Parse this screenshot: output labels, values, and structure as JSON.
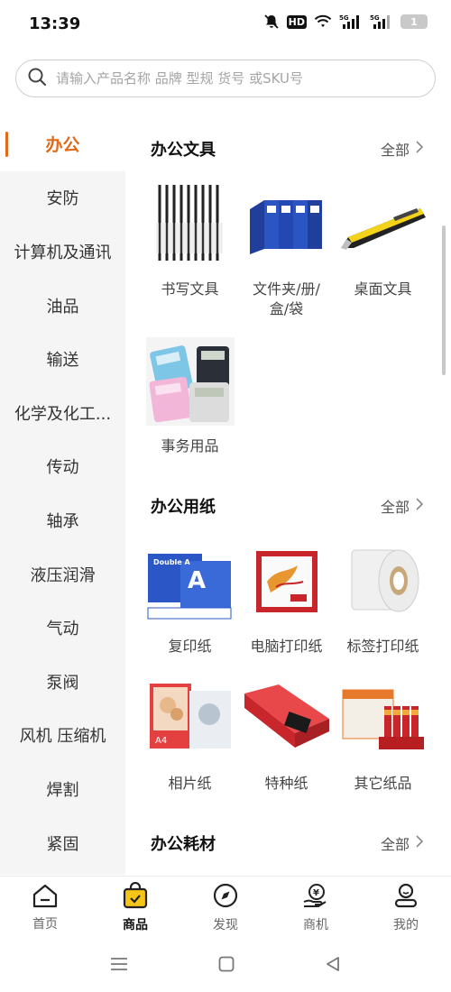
{
  "status": {
    "time": "13:39",
    "hd": "HD",
    "net1": "5G",
    "net2": "5G",
    "battery": "1"
  },
  "search": {
    "placeholder": "请输入产品名称 品牌 型规 货号 或SKU号"
  },
  "sidebar": {
    "items": [
      {
        "label": "办公",
        "active": true
      },
      {
        "label": "安防"
      },
      {
        "label": "计算机及通讯"
      },
      {
        "label": "油品"
      },
      {
        "label": "输送"
      },
      {
        "label": "化学及化工..."
      },
      {
        "label": "传动"
      },
      {
        "label": "轴承"
      },
      {
        "label": "液压润滑"
      },
      {
        "label": "气动"
      },
      {
        "label": "泵阀"
      },
      {
        "label": "风机 压缩机"
      },
      {
        "label": "焊割"
      },
      {
        "label": "紧固"
      }
    ]
  },
  "sections": [
    {
      "title": "办公文具",
      "more": "全部",
      "items": [
        {
          "label": "书写文具",
          "icon": "pens-icon"
        },
        {
          "label": "文件夹/册/\n盒/袋",
          "icon": "binders-icon"
        },
        {
          "label": "桌面文具",
          "icon": "cutter-icon"
        },
        {
          "label": "事务用品",
          "icon": "calculator-icon"
        }
      ]
    },
    {
      "title": "办公用纸",
      "more": "全部",
      "items": [
        {
          "label": "复印纸",
          "icon": "copy-paper-icon",
          "brand": "Double A"
        },
        {
          "label": "电脑打印纸",
          "icon": "printer-paper-icon"
        },
        {
          "label": "标签打印纸",
          "icon": "label-roll-icon"
        },
        {
          "label": "相片纸",
          "icon": "photo-paper-icon",
          "brand": "A4"
        },
        {
          "label": "特种纸",
          "icon": "special-paper-icon"
        },
        {
          "label": "其它纸品",
          "icon": "other-paper-icon"
        }
      ]
    },
    {
      "title": "办公耗材",
      "more": "全部",
      "items": []
    }
  ],
  "bottom_nav": [
    {
      "label": "首页",
      "icon": "home-icon"
    },
    {
      "label": "商品",
      "icon": "shopping-bag-icon",
      "active": true
    },
    {
      "label": "发现",
      "icon": "compass-icon"
    },
    {
      "label": "商机",
      "icon": "yen-hand-icon"
    },
    {
      "label": "我的",
      "icon": "user-icon"
    }
  ],
  "colors": {
    "accent": "#e06a1a",
    "sidebar_bg": "#f5f5f5",
    "bag_yellow": "#f5c518"
  }
}
